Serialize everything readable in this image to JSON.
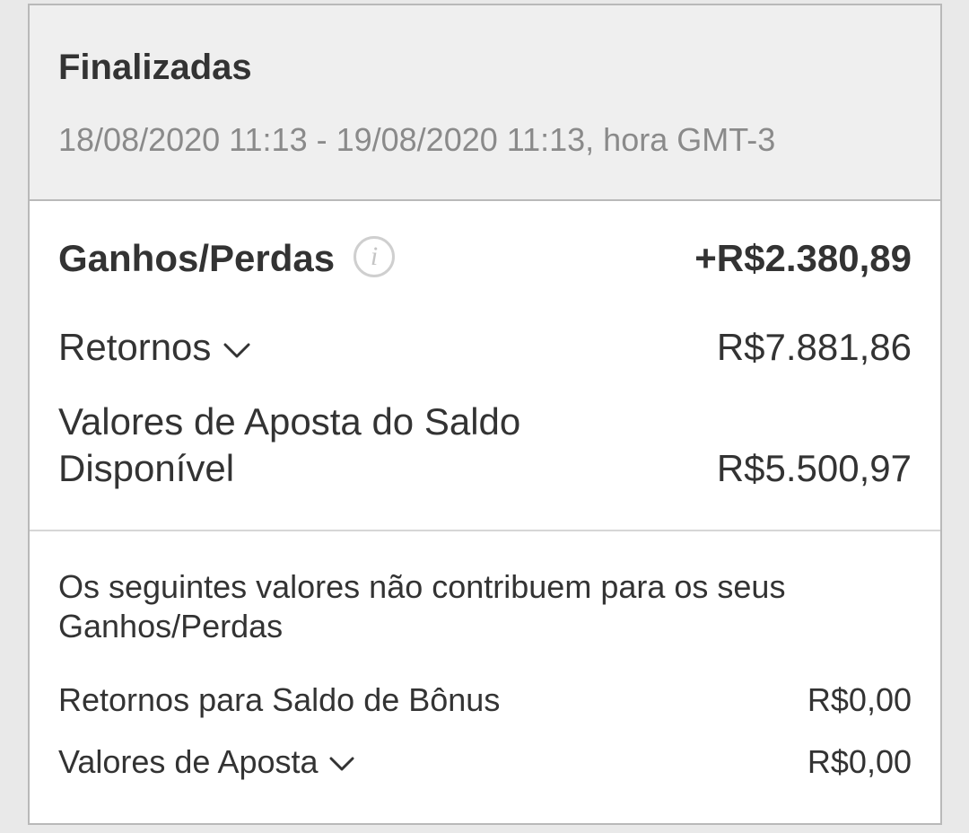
{
  "header": {
    "title": "Finalizadas",
    "date_range": "18/08/2020 11:13 - 19/08/2020 11:13, hora GMT-3"
  },
  "summary": {
    "profit_loss_label": "Ganhos/Perdas",
    "profit_loss_value": "+R$2.380,89",
    "returns_label": "Retornos",
    "returns_value": "R$7.881,86",
    "stakes_label_line1": "Valores de Aposta do Saldo",
    "stakes_label_line2": "Disponível",
    "stakes_value": "R$5.500,97"
  },
  "non_contributing": {
    "note_line1": "Os seguintes valores não contribuem para os seus",
    "note_line2": "Ganhos/Perdas",
    "bonus_returns_label": "Retornos para Saldo de Bônus",
    "bonus_returns_value": "R$0,00",
    "bonus_stakes_label": "Valores de Aposta",
    "bonus_stakes_value": "R$0,00"
  },
  "icons": {
    "info": "info-icon",
    "expand": "chevron-down-icon"
  },
  "colors": {
    "header_background": "#efefef",
    "border": "#b9b9b9",
    "text": "#333333",
    "muted_text": "#8a8a8a"
  }
}
